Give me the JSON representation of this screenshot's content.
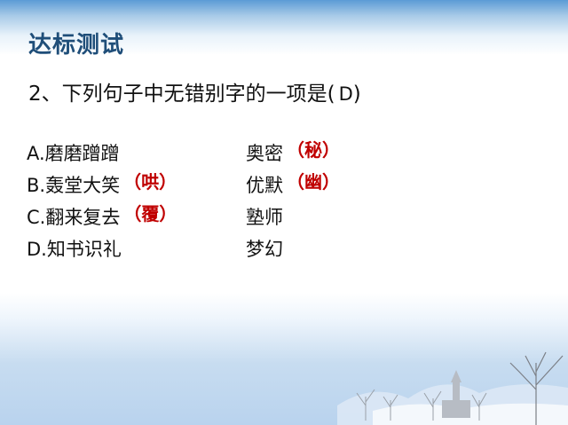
{
  "title": "达标测试",
  "question": {
    "text": "2、下列句子中无错别字的一项是",
    "answer_open": "(",
    "answer": "D",
    "answer_close": ")"
  },
  "options": [
    {
      "left": "A.磨磨蹭蹭",
      "left_fix": "",
      "right": "奥密",
      "right_fix": "（秘）"
    },
    {
      "left": "B.轰堂大笑",
      "left_fix": "（哄）",
      "right": "优默",
      "right_fix": "（幽）"
    },
    {
      "left": "C.翻来复去",
      "left_fix": "（覆）",
      "right": "塾师",
      "right_fix": ""
    },
    {
      "left": "D.知书识礼",
      "left_fix": "",
      "right": "梦幻",
      "right_fix": ""
    }
  ],
  "colors": {
    "title": "#1f4e79",
    "correction": "#c00000"
  }
}
